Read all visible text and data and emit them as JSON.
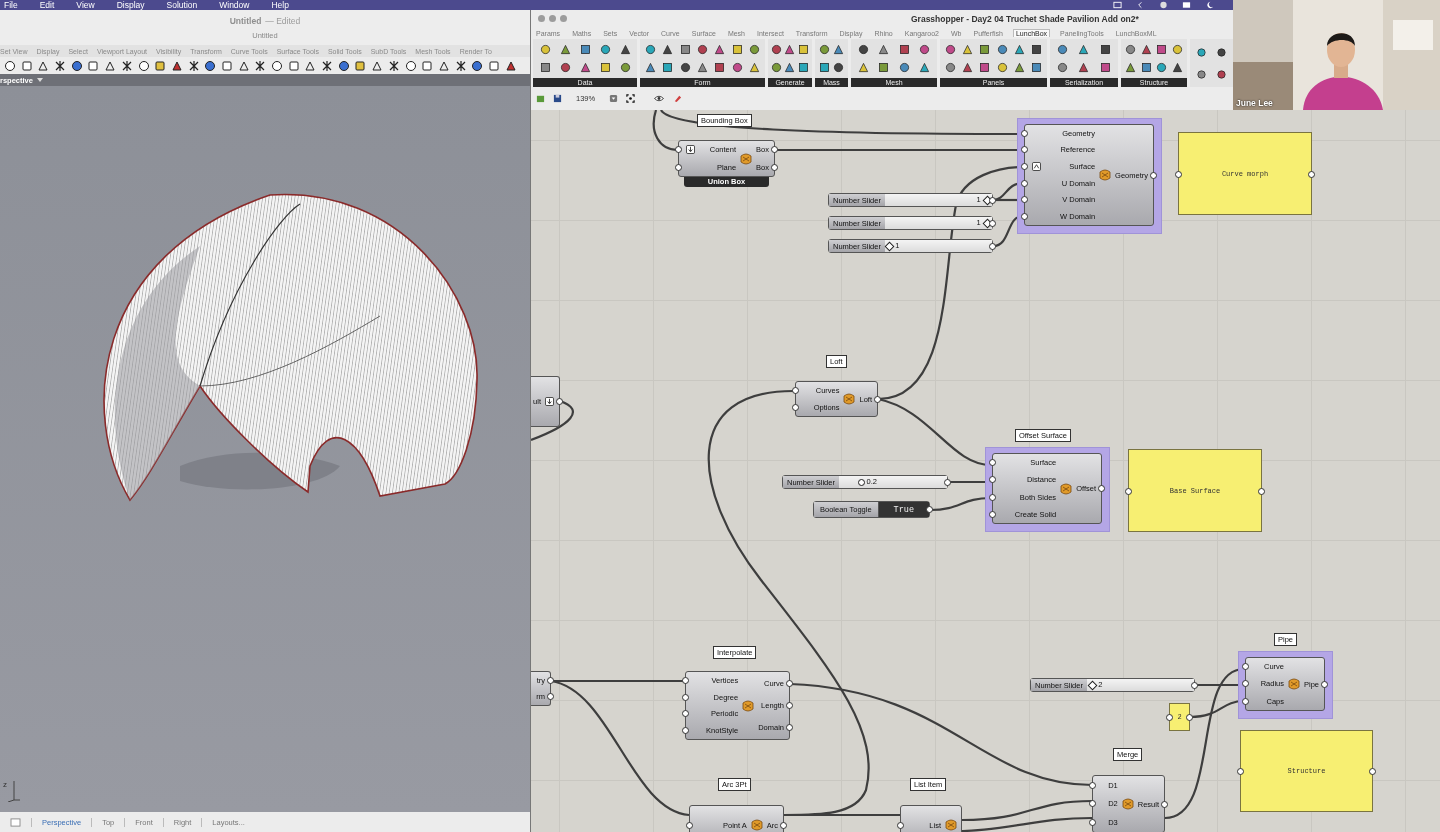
{
  "menu_bar": {
    "items": [
      "File",
      "Edit",
      "View",
      "Display",
      "Solution",
      "Window",
      "Help"
    ]
  },
  "rhino": {
    "title": "Untitled",
    "title_status": "— Edited",
    "subtitle": "Untitled",
    "tabs": [
      {
        "label": "Set View",
        "selected": false
      },
      {
        "label": "Display",
        "selected": false
      },
      {
        "label": "Select",
        "selected": false
      },
      {
        "label": "Viewport Layout",
        "selected": false
      },
      {
        "label": "Visibility",
        "selected": false
      },
      {
        "label": "Transform",
        "selected": false
      },
      {
        "label": "Curve Tools",
        "selected": false
      },
      {
        "label": "Surface Tools",
        "selected": false
      },
      {
        "label": "Solid Tools",
        "selected": false
      },
      {
        "label": "SubD Tools",
        "selected": false
      },
      {
        "label": "Mesh Tools",
        "selected": false
      },
      {
        "label": "Render To",
        "selected": false
      }
    ],
    "viewport_label": "rspective",
    "axis_label": "z",
    "viewport_tabs": [
      {
        "label": "Perspective",
        "selected": true
      },
      {
        "label": "Top",
        "selected": false
      },
      {
        "label": "Front",
        "selected": false
      },
      {
        "label": "Right",
        "selected": false
      },
      {
        "label": "Layouts...",
        "selected": false
      }
    ]
  },
  "grasshopper": {
    "title": "Grasshopper - Day2 04 Truchet Shade Pavilion Add on2*",
    "tabs": [
      {
        "label": "Params",
        "selected": false
      },
      {
        "label": "Maths",
        "selected": false
      },
      {
        "label": "Sets",
        "selected": false
      },
      {
        "label": "Vector",
        "selected": false
      },
      {
        "label": "Curve",
        "selected": false
      },
      {
        "label": "Surface",
        "selected": false
      },
      {
        "label": "Mesh",
        "selected": false
      },
      {
        "label": "Intersect",
        "selected": false
      },
      {
        "label": "Transform",
        "selected": false
      },
      {
        "label": "Display",
        "selected": false
      },
      {
        "label": "Rhino",
        "selected": false
      },
      {
        "label": "Kangaroo2",
        "selected": false
      },
      {
        "label": "Wb",
        "selected": false
      },
      {
        "label": "Pufferfish",
        "selected": false
      },
      {
        "label": "LunchBox",
        "selected": true
      },
      {
        "label": "PanelingTools",
        "selected": false
      },
      {
        "label": "LunchBoxML",
        "selected": false
      }
    ],
    "groups": [
      "Data",
      "Form",
      "Generate",
      "Mass",
      "Mesh",
      "Panels",
      "Serialization",
      "Structure"
    ],
    "zoom": "139%"
  },
  "video": {
    "name": "June Lee"
  },
  "canvas": {
    "nodes": [
      {
        "kind": "component",
        "tooltip": "Bounding Box",
        "inputs": [
          {
            "label": "Content",
            "kind": "flatten"
          },
          {
            "label": "Plane",
            "kind": "plain"
          }
        ],
        "outputs": [
          {
            "label": "Box"
          },
          {
            "label": "Box"
          }
        ],
        "footer": "Union Box",
        "selected": false
      },
      {
        "kind": "component",
        "inputs": [
          {
            "label": "Geometry",
            "kind": "plain"
          },
          {
            "label": "Reference",
            "kind": "plain"
          },
          {
            "label": "Surface",
            "kind": "reparameterize"
          },
          {
            "label": "U Domain",
            "kind": "plain"
          },
          {
            "label": "V Domain",
            "kind": "plain"
          },
          {
            "label": "W Domain",
            "kind": "plain"
          }
        ],
        "outputs": [
          {
            "label": "Geometry"
          }
        ],
        "selected": true
      },
      {
        "kind": "panel",
        "text": "Curve morph"
      },
      {
        "kind": "slider",
        "label": "Number Slider",
        "value": "1",
        "integer": true,
        "level": 0.95
      },
      {
        "kind": "slider",
        "label": "Number Slider",
        "value": "1",
        "integer": true,
        "level": 0.95
      },
      {
        "kind": "slider",
        "label": "Number Slider",
        "value": "1",
        "integer": true,
        "level": 0.04
      },
      {
        "kind": "partial",
        "outputs": [
          {
            "label": "ult",
            "kind": "flatten"
          }
        ]
      },
      {
        "kind": "component",
        "tooltip": "Loft",
        "inputs": [
          {
            "label": "Curves"
          },
          {
            "label": "Options"
          }
        ],
        "outputs": [
          {
            "label": "Loft"
          }
        ],
        "selected": false
      },
      {
        "kind": "component",
        "tooltip": "Offset Surface",
        "inputs": [
          {
            "label": "Surface"
          },
          {
            "label": "Distance"
          },
          {
            "label": "Both Sides"
          },
          {
            "label": "Create Solid"
          }
        ],
        "outputs": [
          {
            "label": "Offset"
          }
        ],
        "selected": true
      },
      {
        "kind": "panel",
        "text": "Base Surface"
      },
      {
        "kind": "slider",
        "label": "Number Slider",
        "value": "0.2",
        "integer": false,
        "level": 0.2
      },
      {
        "kind": "toggle",
        "label": "Boolean Toggle",
        "value": "True",
        "on": true
      },
      {
        "kind": "partial",
        "outputs": [
          {
            "label": "try"
          },
          {
            "label": "rm"
          }
        ]
      },
      {
        "kind": "component",
        "tooltip": "Interpolate",
        "inputs": [
          {
            "label": "Vertices"
          },
          {
            "label": "Degree"
          },
          {
            "label": "Periodic"
          },
          {
            "label": "KnotStyle"
          }
        ],
        "outputs": [
          {
            "label": "Curve"
          },
          {
            "label": "Length"
          },
          {
            "label": "Domain"
          }
        ],
        "selected": false
      },
      {
        "kind": "component",
        "tooltip": "Pipe",
        "inputs": [
          {
            "label": "Curve"
          },
          {
            "label": "Radius"
          },
          {
            "label": "Caps"
          }
        ],
        "outputs": [
          {
            "label": "Pipe"
          }
        ],
        "selected": true
      },
      {
        "kind": "slider",
        "label": "Number Slider",
        "value": "2",
        "integer": true,
        "level": 0.05
      },
      {
        "kind": "panel",
        "text": "2"
      },
      {
        "kind": "panel",
        "text": "Structure"
      },
      {
        "kind": "component",
        "tooltip": "Arc 3Pt",
        "inputs": [
          {
            "label": "Point A"
          }
        ],
        "outputs": [
          {
            "label": "Arc"
          }
        ],
        "selected": false
      },
      {
        "kind": "component",
        "tooltip": "List Item",
        "inputs": [
          {
            "label": "List"
          }
        ],
        "selected": false
      },
      {
        "kind": "component",
        "tooltip": "Merge",
        "inputs": [
          {
            "label": "D1"
          },
          {
            "label": "D2"
          },
          {
            "label": "D3"
          }
        ],
        "outputs": [
          {
            "label": "Result"
          }
        ],
        "selected": false
      }
    ]
  }
}
